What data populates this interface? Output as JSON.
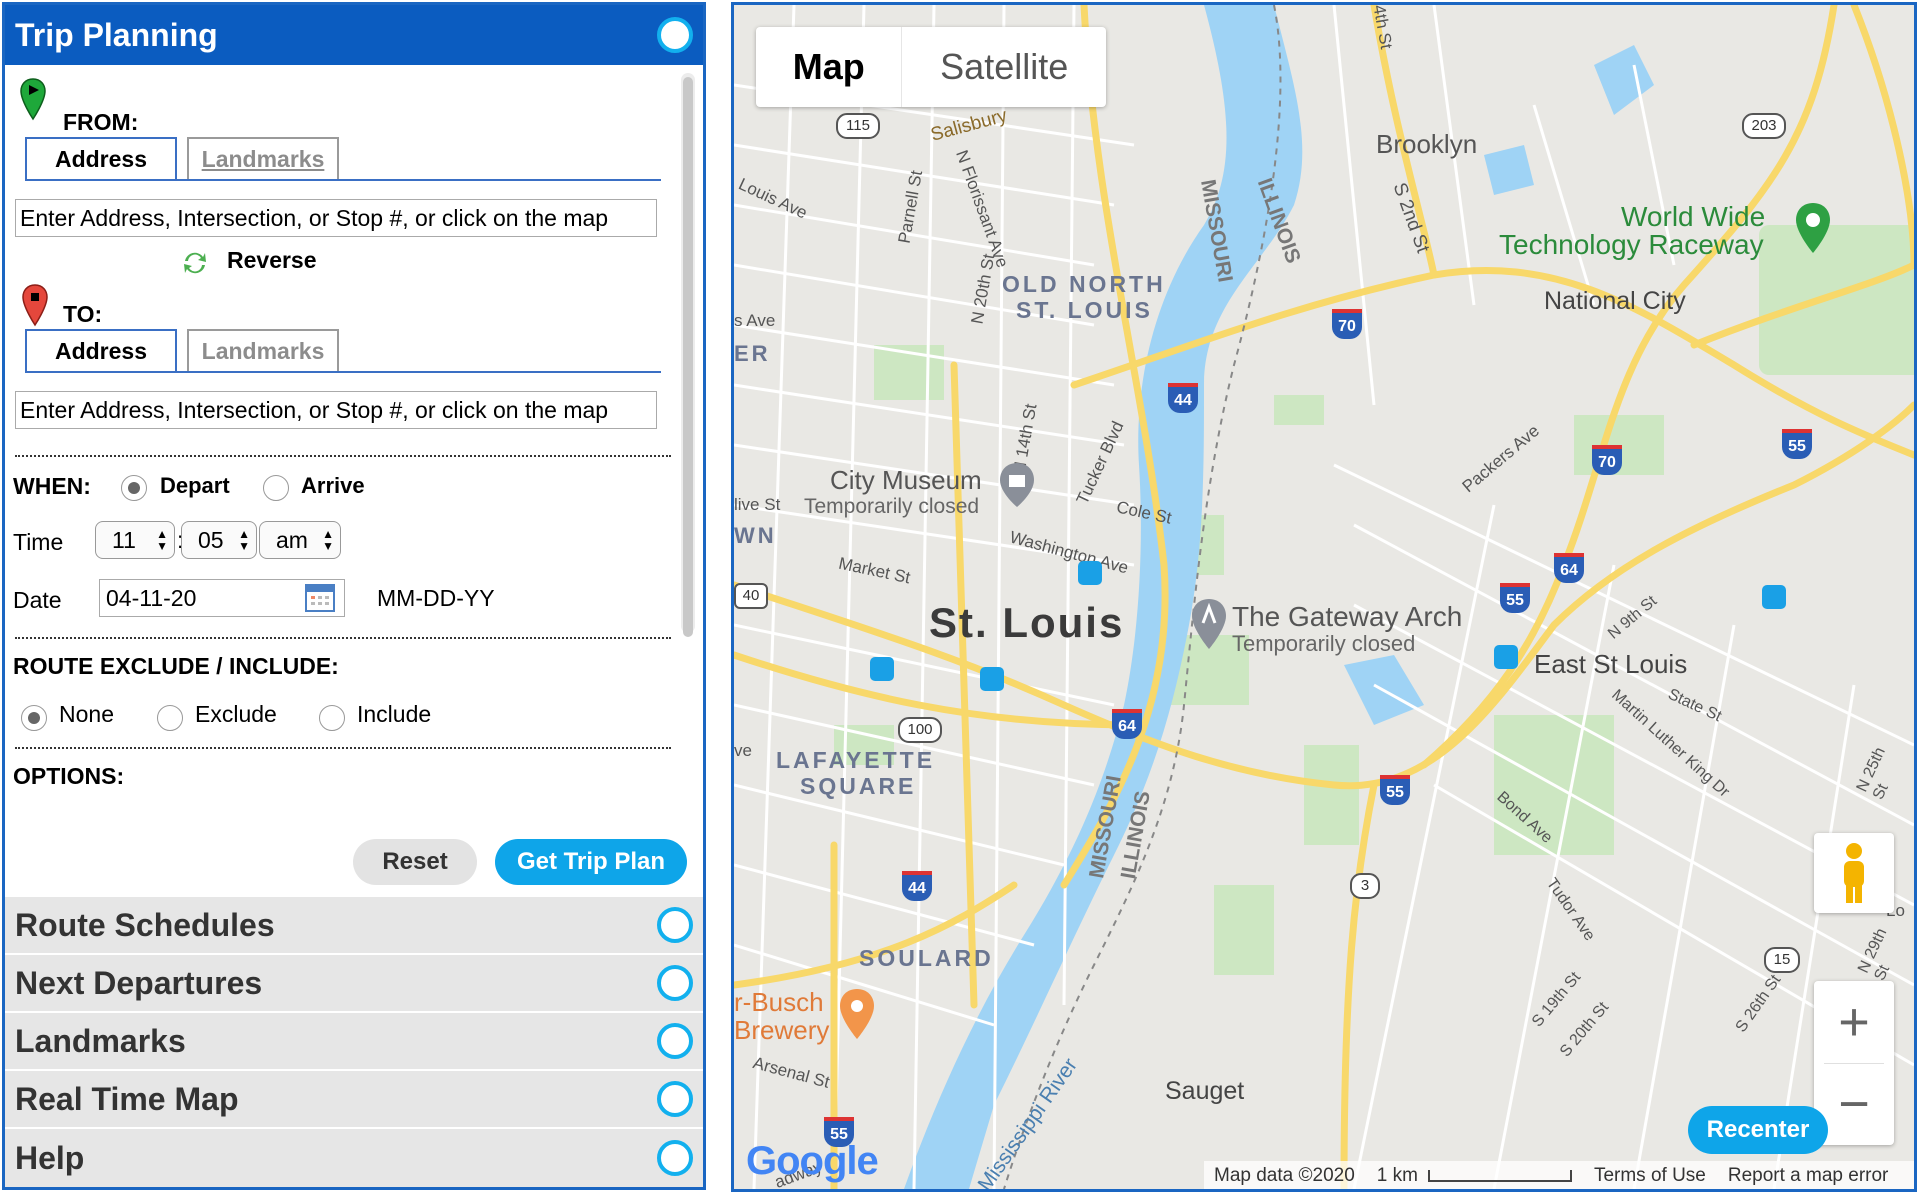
{
  "trip": {
    "title": "Trip Planning",
    "from_label": "FROM:",
    "to_label": "TO:",
    "tab_address": "Address",
    "tab_landmarks": "Landmarks",
    "from_placeholder": "Enter Address, Intersection, or Stop #, or click on the map",
    "to_placeholder": "Enter Address, Intersection, or Stop #, or click on the map",
    "reverse": "Reverse",
    "when_label": "WHEN:",
    "depart": "Depart",
    "arrive": "Arrive",
    "time_label": "Time",
    "time_hour": "11",
    "time_sep": ":",
    "time_min": "05",
    "time_ampm": "am",
    "date_label": "Date",
    "date_value": "04-11-20",
    "date_format": "MM-DD-YY",
    "route_label": "ROUTE EXCLUDE / INCLUDE:",
    "opt_none": "None",
    "opt_exclude": "Exclude",
    "opt_include": "Include",
    "options_label": "OPTIONS:",
    "reset": "Reset",
    "get_plan": "Get Trip Plan"
  },
  "accordion": [
    "Route Schedules",
    "Next Departures",
    "Landmarks",
    "Real Time Map",
    "Help"
  ],
  "map": {
    "type_map": "Map",
    "type_satellite": "Satellite",
    "recenter": "Recenter",
    "logo": "Google",
    "attribution": "Map data ©2020",
    "scale": "1 km",
    "terms": "Terms of Use",
    "report": "Report a map error",
    "labels": {
      "brooklyn": "Brooklyn",
      "wwt1": "World Wide",
      "wwt2": "Technology Raceway",
      "national_city": "National City",
      "old_north1": "OLD NORTH",
      "old_north2": "ST. LOUIS",
      "city_museum": "City Museum",
      "temp_closed": "Temporarily closed",
      "stlouis": "St. Louis",
      "gateway": "The Gateway Arch",
      "east_stl": "East St Louis",
      "lafayette1": "LAFAYETTE",
      "lafayette2": "SQUARE",
      "soulard": "SOULARD",
      "busch1": "r-Busch",
      "busch2": "Brewery",
      "sauget": "Sauget",
      "missouri": "MISSOURI",
      "illinois": "ILLINOIS",
      "mississippi": "Mississippi River",
      "salisbury": "Salisbury",
      "washington": "Washington Ave",
      "market": "Market St",
      "cole": "Cole St",
      "tucker": "Tucker Blvd",
      "n14": "N 14th St",
      "n20": "N 20th St",
      "parnell": "Parnell St",
      "florissant": "N Florissant Ave",
      "louis_ave": "Louis Ave",
      "packers": "Packers Ave",
      "s2nd": "S 2nd St",
      "n9th": "N 9th St",
      "state": "State St",
      "mlk": "Martin Luther King Dr",
      "bond": "Bond Ave",
      "tudor": "Tudor Ave",
      "s19": "S 19th St",
      "s20": "S 20th St",
      "s26": "S 26th St",
      "n25": "N 25th St",
      "n29": "N 29th St",
      "arsenal": "Arsenal St",
      "ath": "4th St",
      "wn": "WN",
      "er": "ER",
      "s_ave": "s Ave",
      "live_st": "live St",
      "ve": "ve",
      "lo": "Lo",
      "way": "adway"
    },
    "shields": {
      "i70a": "70",
      "i70b": "70",
      "i44a": "44",
      "i44b": "44",
      "i55a": "55",
      "i55b": "55",
      "i55c": "55",
      "i55d": "55",
      "i64a": "64",
      "i64b": "64",
      "r115": "115",
      "r203": "203",
      "r40": "40",
      "r100": "100",
      "r3": "3",
      "r15": "15"
    }
  }
}
